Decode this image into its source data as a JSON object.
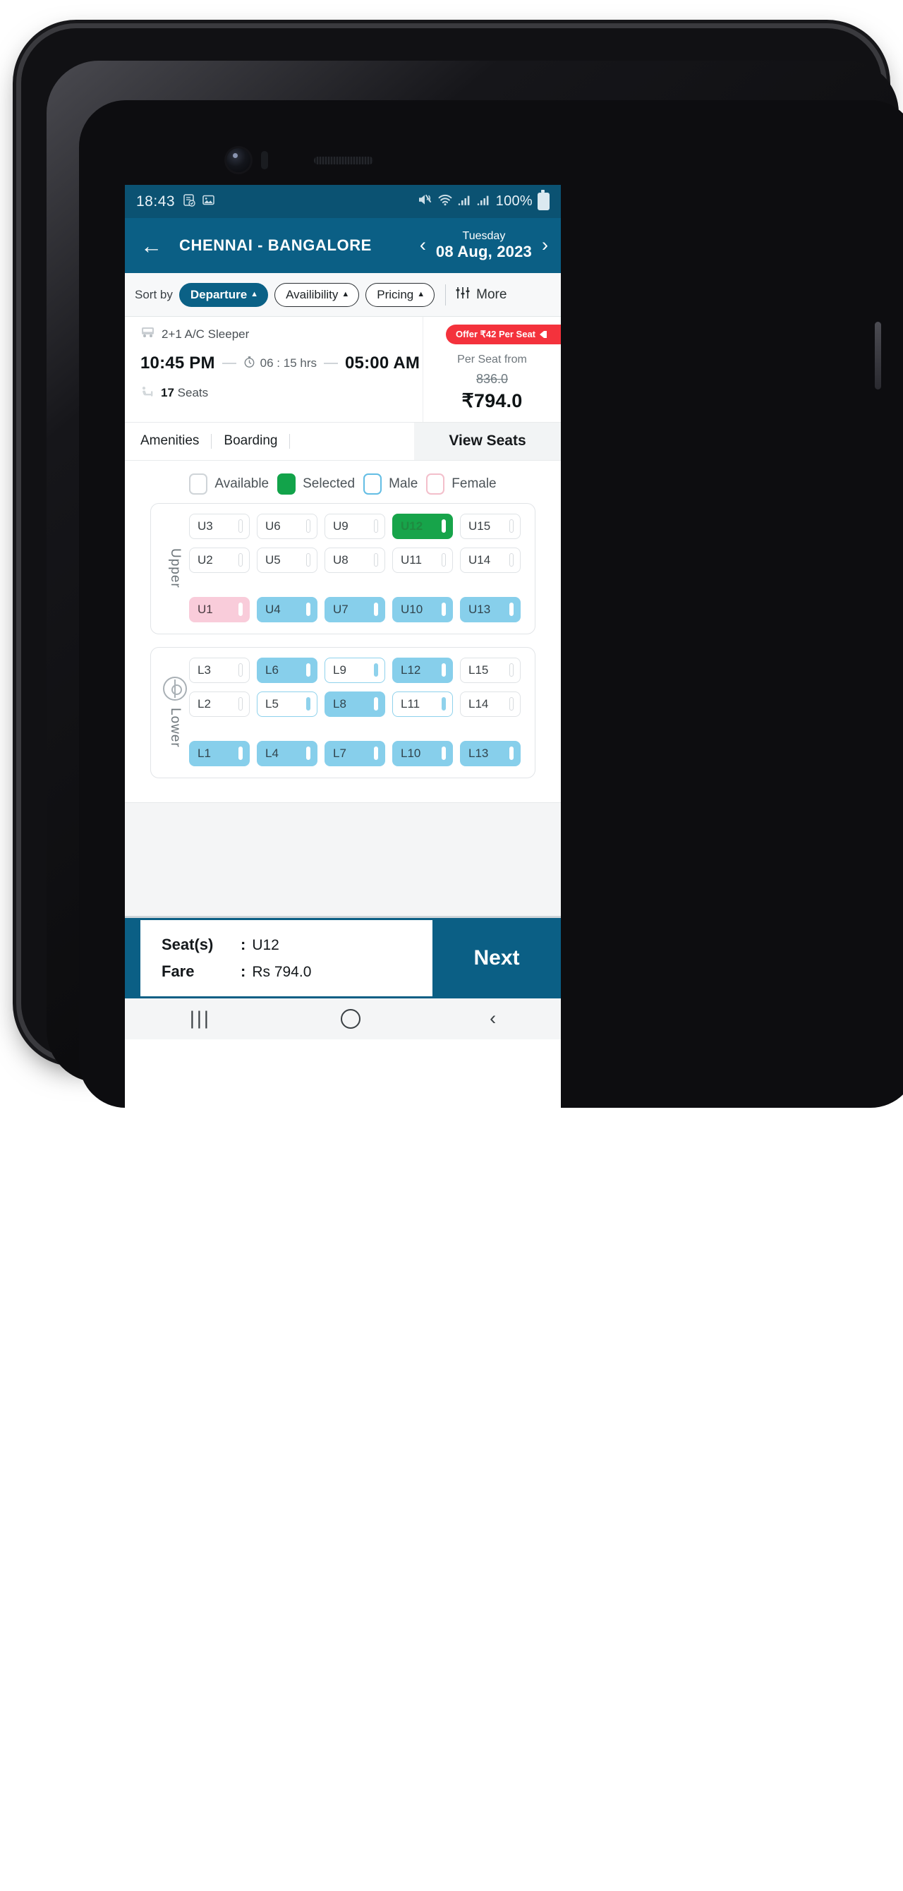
{
  "status_bar": {
    "time": "18:43",
    "left_icons": [
      "sim-card-icon",
      "photo-icon"
    ],
    "right_icons": [
      "mute-icon",
      "wifi-icon",
      "signal-icon",
      "signal-icon"
    ],
    "battery_percent": "100%"
  },
  "header": {
    "back_icon": "back-arrow-icon",
    "route_title": "CHENNAI - BANGALORE",
    "weekday": "Tuesday",
    "date": "08 Aug, 2023",
    "prev_icon": "chevron-left-icon",
    "next_icon": "chevron-right-icon",
    "bg_color": "#0b5f85"
  },
  "sort_bar": {
    "label": "Sort by",
    "chips": [
      {
        "label": "Departure",
        "active": true
      },
      {
        "label": "Availibility",
        "active": false
      },
      {
        "label": "Pricing",
        "active": false
      }
    ],
    "more_label": "More",
    "more_icon": "filter-sliders-icon"
  },
  "bus_card": {
    "bus_icon": "bus-icon",
    "bus_type": "2+1 A/C Sleeper",
    "offer_badge": "Offer ₹42 Per Seat",
    "departure_time": "10:45 PM",
    "duration": "06 : 15 hrs",
    "duration_icon": "stopwatch-icon",
    "arrival_time": "05:00 AM",
    "seats_icon": "seat-icon",
    "seats_available": "17",
    "seats_suffix": "Seats",
    "per_seat_label": "Per Seat from",
    "price_original": "836.0",
    "price_final": "₹794.0",
    "offer_color": "#f4323c"
  },
  "tabs": {
    "items": [
      "Amenities",
      "Boarding"
    ],
    "view_seats": "View Seats"
  },
  "legend": [
    {
      "label": "Available",
      "state": "available"
    },
    {
      "label": "Selected",
      "state": "selected"
    },
    {
      "label": "Male",
      "state": "male"
    },
    {
      "label": "Female",
      "state": "female"
    }
  ],
  "decks": [
    {
      "name": "Upper",
      "icon": null,
      "rows": [
        [
          {
            "id": "U3",
            "state": "available"
          },
          {
            "id": "U6",
            "state": "available"
          },
          {
            "id": "U9",
            "state": "available"
          },
          {
            "id": "U12",
            "state": "selected"
          },
          {
            "id": "U15",
            "state": "available"
          }
        ],
        [
          {
            "id": "U2",
            "state": "available"
          },
          {
            "id": "U5",
            "state": "available"
          },
          {
            "id": "U8",
            "state": "available"
          },
          {
            "id": "U11",
            "state": "available"
          },
          {
            "id": "U14",
            "state": "available"
          }
        ],
        [
          {
            "id": "U1",
            "state": "female-booked"
          },
          {
            "id": "U4",
            "state": "male-booked"
          },
          {
            "id": "U7",
            "state": "male-booked"
          },
          {
            "id": "U10",
            "state": "male-booked"
          },
          {
            "id": "U13",
            "state": "male-booked"
          }
        ]
      ]
    },
    {
      "name": "Lower",
      "icon": "steering-wheel-icon",
      "rows": [
        [
          {
            "id": "L3",
            "state": "available"
          },
          {
            "id": "L6",
            "state": "male-booked"
          },
          {
            "id": "L9",
            "state": "male-outline"
          },
          {
            "id": "L12",
            "state": "male-booked"
          },
          {
            "id": "L15",
            "state": "available"
          }
        ],
        [
          {
            "id": "L2",
            "state": "available"
          },
          {
            "id": "L5",
            "state": "male-outline"
          },
          {
            "id": "L8",
            "state": "male-booked"
          },
          {
            "id": "L11",
            "state": "male-outline"
          },
          {
            "id": "L14",
            "state": "available"
          }
        ],
        [
          {
            "id": "L1",
            "state": "male-booked"
          },
          {
            "id": "L4",
            "state": "male-booked"
          },
          {
            "id": "L7",
            "state": "male-booked"
          },
          {
            "id": "L10",
            "state": "male-booked"
          },
          {
            "id": "L13",
            "state": "male-booked"
          }
        ]
      ]
    }
  ],
  "bottom_bar": {
    "seats_key": "Seat(s)",
    "seats_value": "U12",
    "fare_key": "Fare",
    "fare_value": "Rs 794.0",
    "colon": ":",
    "next_label": "Next"
  },
  "android_nav": {
    "recent_icon": "recent-apps-icon",
    "home_icon": "home-icon",
    "back_icon": "nav-back-icon"
  },
  "colors": {
    "brand": "#0b5f85",
    "status_bar": "#0b5272",
    "selected_green": "#17a44a",
    "male_blue": "#87cfeb",
    "female_pink": "#f9ccda",
    "offer_red": "#f4323c"
  }
}
